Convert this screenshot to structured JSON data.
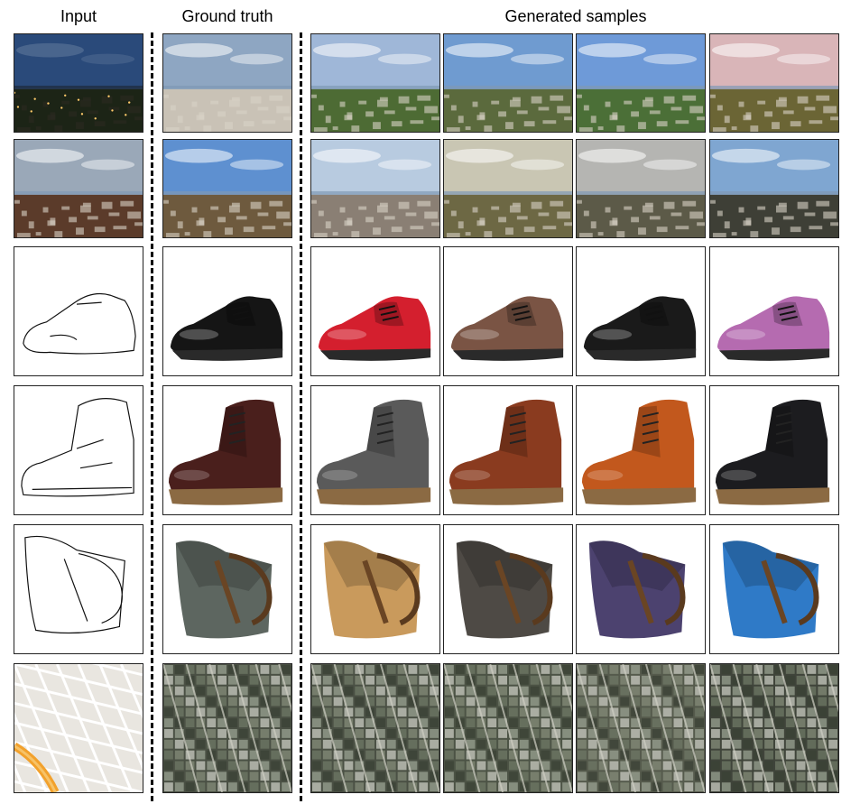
{
  "headers": {
    "input": "Input",
    "ground_truth": "Ground truth",
    "generated": "Generated samples"
  },
  "rows": [
    {
      "kind": "night-to-day-landscape",
      "input": "night-landscape",
      "ground_truth": "day-landscape",
      "samples": [
        {
          "sky": "#9fb7d8",
          "ground": "#4d6b34"
        },
        {
          "sky": "#6f9bd0",
          "ground": "#5b6a3d"
        },
        {
          "sky": "#6e9ad8",
          "ground": "#4b6f37"
        },
        {
          "sky": "#d9b5b8",
          "ground": "#6b6535"
        }
      ]
    },
    {
      "kind": "night-to-day-town",
      "input": "dusk-town",
      "ground_truth": "day-town",
      "samples": [
        {
          "sky": "#b8cbe0",
          "ground": "#8a7f74"
        },
        {
          "sky": "#c9c6b3",
          "ground": "#6d6844"
        },
        {
          "sky": "#b5b5b2",
          "ground": "#5c5a48"
        },
        {
          "sky": "#7fa6d1",
          "ground": "#3e3f36"
        }
      ]
    },
    {
      "kind": "edges-to-shoes",
      "input": "shoe-edge-sketch",
      "ground_truth": "black-leather-shoe",
      "samples": [
        {
          "color": "#d41f2e"
        },
        {
          "color": "#7a5444"
        },
        {
          "color": "#1a1a1a"
        },
        {
          "color": "#b56bb0"
        }
      ]
    },
    {
      "kind": "edges-to-boots",
      "input": "boot-edge-sketch",
      "ground_truth": "brown-boot",
      "samples": [
        {
          "color": "#5a5a5a"
        },
        {
          "color": "#8a3b1f"
        },
        {
          "color": "#c2581d"
        },
        {
          "color": "#1c1c1f"
        }
      ]
    },
    {
      "kind": "edges-to-handbags",
      "input": "bag-edge-sketch",
      "ground_truth": "gray-canvas-bag",
      "samples": [
        {
          "color": "#c99a5c"
        },
        {
          "color": "#4e4a45"
        },
        {
          "color": "#4c426f"
        },
        {
          "color": "#2f7ac7"
        }
      ]
    },
    {
      "kind": "map-to-aerial",
      "input": "street-map",
      "ground_truth": "aerial-photo",
      "samples": [
        {
          "color": "#4a5044"
        },
        {
          "color": "#4c5345"
        },
        {
          "color": "#555a4c"
        },
        {
          "color": "#3f443a"
        }
      ]
    }
  ]
}
